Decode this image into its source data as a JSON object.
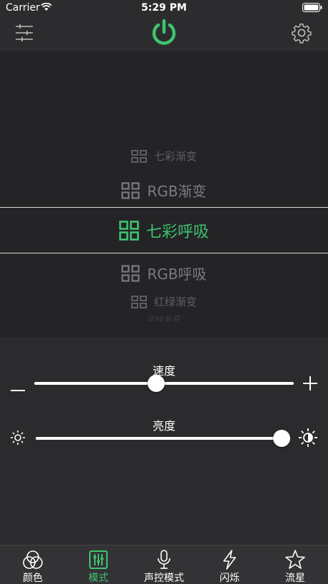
{
  "status_bar": {
    "carrier": "Carrier",
    "time": "5:29 PM"
  },
  "colors": {
    "accent": "#3ec46e",
    "background": "#242427",
    "nav": "#2c2c2e"
  },
  "nav": {
    "left_icon": "sliders-icon",
    "center_icon": "power-icon",
    "right_icon": "gear-icon"
  },
  "mode_picker": {
    "items": [
      "七彩渐变",
      "RGB渐变",
      "七彩呼吸",
      "RGB呼吸",
      "红绿渐变",
      "蓝绿渐变"
    ],
    "selected": "七彩呼吸"
  },
  "speed": {
    "label": "速度",
    "value_fraction": 0.47
  },
  "brightness": {
    "label": "亮度",
    "value_fraction": 1.0
  },
  "tabs": [
    {
      "label": "颜色",
      "icon": "color-circles-icon",
      "active": false
    },
    {
      "label": "模式",
      "icon": "mode-sliders-icon",
      "active": true
    },
    {
      "label": "声控模式",
      "icon": "microphone-icon",
      "active": false
    },
    {
      "label": "闪烁",
      "icon": "lightning-icon",
      "active": false
    },
    {
      "label": "流星",
      "icon": "star-icon",
      "active": false
    }
  ]
}
